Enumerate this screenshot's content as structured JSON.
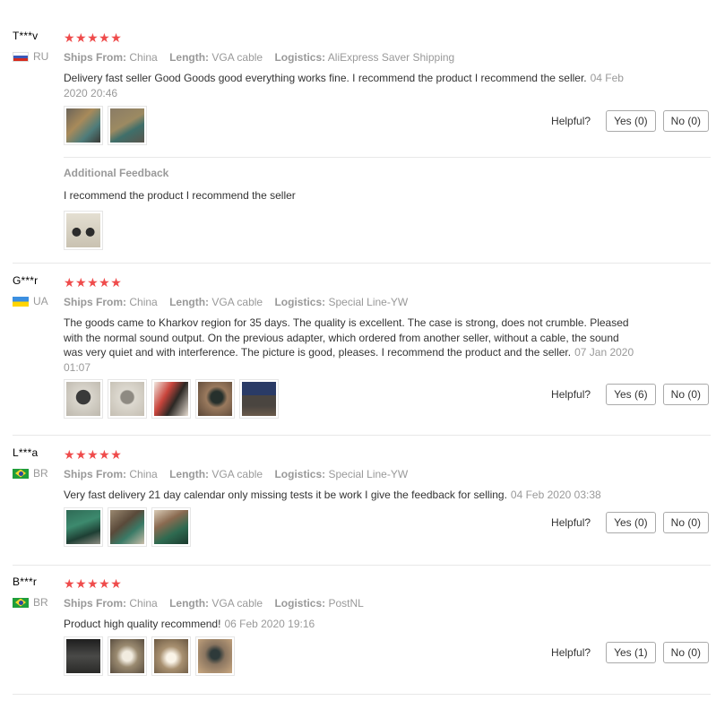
{
  "labels": {
    "ships_from": "Ships From:",
    "length": "Length:",
    "logistics": "Logistics:",
    "helpful": "Helpful?",
    "additional_feedback": "Additional Feedback"
  },
  "stars": "★★★★★",
  "reviews": [
    {
      "user": "T***v",
      "country": "RU",
      "rating": 5,
      "ships_from": "China",
      "length": "VGA cable",
      "logistics": "AliExpress Saver Shipping",
      "text": "Delivery fast seller Good Goods good everything works fine. I recommend the product I recommend the seller.",
      "date": "04 Feb 2020 20:46",
      "yes": "Yes (0)",
      "no": "No (0)",
      "additional_text": "I recommend the product I recommend the seller"
    },
    {
      "user": "G***r",
      "country": "UA",
      "rating": 5,
      "ships_from": "China",
      "length": "VGA cable",
      "logistics": "Special Line-YW",
      "text": "The goods came to Kharkov region for 35 days. The quality is excellent. The case is strong, does not crumble. Pleased with the normal sound output. On the previous adapter, which ordered from another seller, without a cable, the sound was very quiet and with interference. The picture is good, pleases. I recommend the product and the seller.",
      "date": "07 Jan 2020 01:07",
      "yes": "Yes (6)",
      "no": "No (0)"
    },
    {
      "user": "L***a",
      "country": "BR",
      "rating": 5,
      "ships_from": "China",
      "length": "VGA cable",
      "logistics": "Special Line-YW",
      "text": "Very fast delivery 21 day calendar only missing tests it be work I give the feedback for selling.",
      "date": "04 Feb 2020 03:38",
      "yes": "Yes (0)",
      "no": "No (0)"
    },
    {
      "user": "B***r",
      "country": "BR",
      "rating": 5,
      "ships_from": "China",
      "length": "VGA cable",
      "logistics": "PostNL",
      "text": "Product high quality recommend!",
      "date": "06 Feb 2020 19:16",
      "yes": "Yes (1)",
      "no": "No (0)"
    }
  ]
}
